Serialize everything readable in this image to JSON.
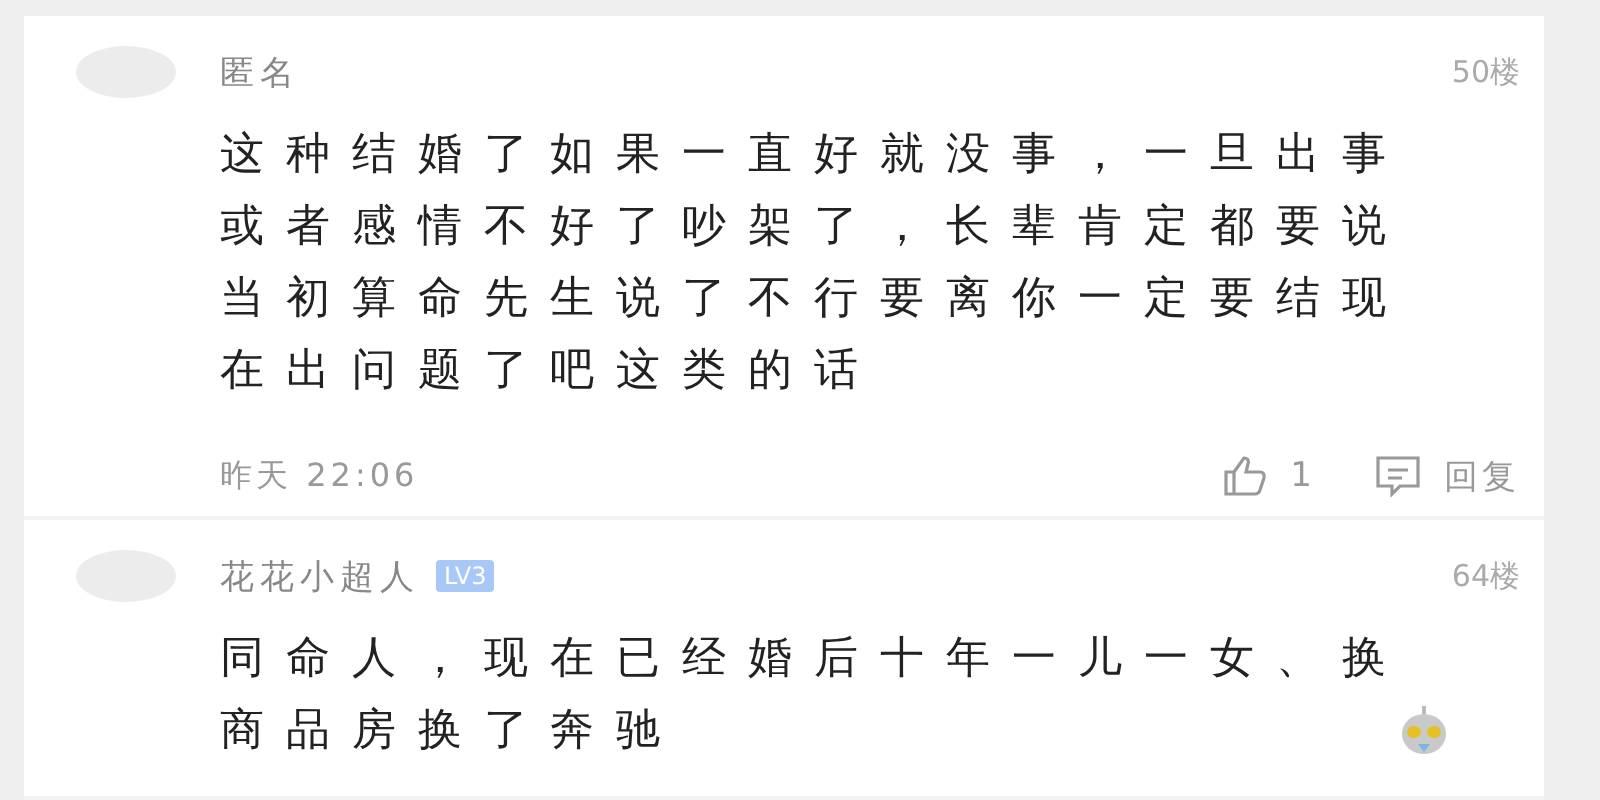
{
  "comments": [
    {
      "author": "匿名",
      "floor": "50楼",
      "lines": [
        "这种结婚了如果一直好就没事，一旦出事",
        "或者感情不好了吵架了，长辈肯定都要说",
        "当初算命先生说了不行要离你一定要结现",
        "在出问题了吧这类的话"
      ],
      "time": "昨天 22:06",
      "likes": "1",
      "reply": "回复"
    },
    {
      "author": "花花小超人",
      "level": "LV3",
      "floor": "64楼",
      "lines": [
        "同命人，现在已经婚后十年一儿一女、换",
        "商品房换了奔驰"
      ],
      "sticker": {
        "kind": "robot"
      }
    }
  ]
}
